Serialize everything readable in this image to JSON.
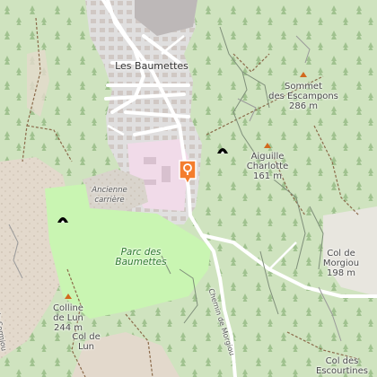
{
  "map": {
    "places": {
      "town": "Les Baumettes",
      "park_line1": "Parc des",
      "park_line2": "Baumettes",
      "quarry_line1": "Ancienne",
      "quarry_line2": "carrière",
      "road": "Chemin de Morgiou",
      "road_edge": "de Sormiou"
    },
    "peaks": [
      {
        "name": "Sommet",
        "name2": "des Escampons",
        "elevation": "286 m"
      },
      {
        "name": "Aiguille",
        "name2": "Charlotte",
        "elevation": "161 m"
      },
      {
        "name": "Col de",
        "name2": "Morgiou",
        "elevation": "198 m"
      },
      {
        "name": "Colline",
        "name2": "de Lun",
        "elevation": "244 m"
      },
      {
        "name": "Col de",
        "name2": "Lun",
        "elevation": ""
      },
      {
        "name": "Col des",
        "name2": "Escourtines",
        "elevation": ""
      }
    ],
    "colors": {
      "forest": "#cfe3bf",
      "park": "#c9f5b2",
      "residential": "#e0dfdf",
      "campus": "#f1dbe9",
      "scrub": "#e3d9cc",
      "trail": "#8b6a4a",
      "pin": "#f47d2d"
    },
    "icons": [
      "map-pin-icon",
      "cave-icon",
      "peak-icon",
      "tree-icon"
    ]
  }
}
